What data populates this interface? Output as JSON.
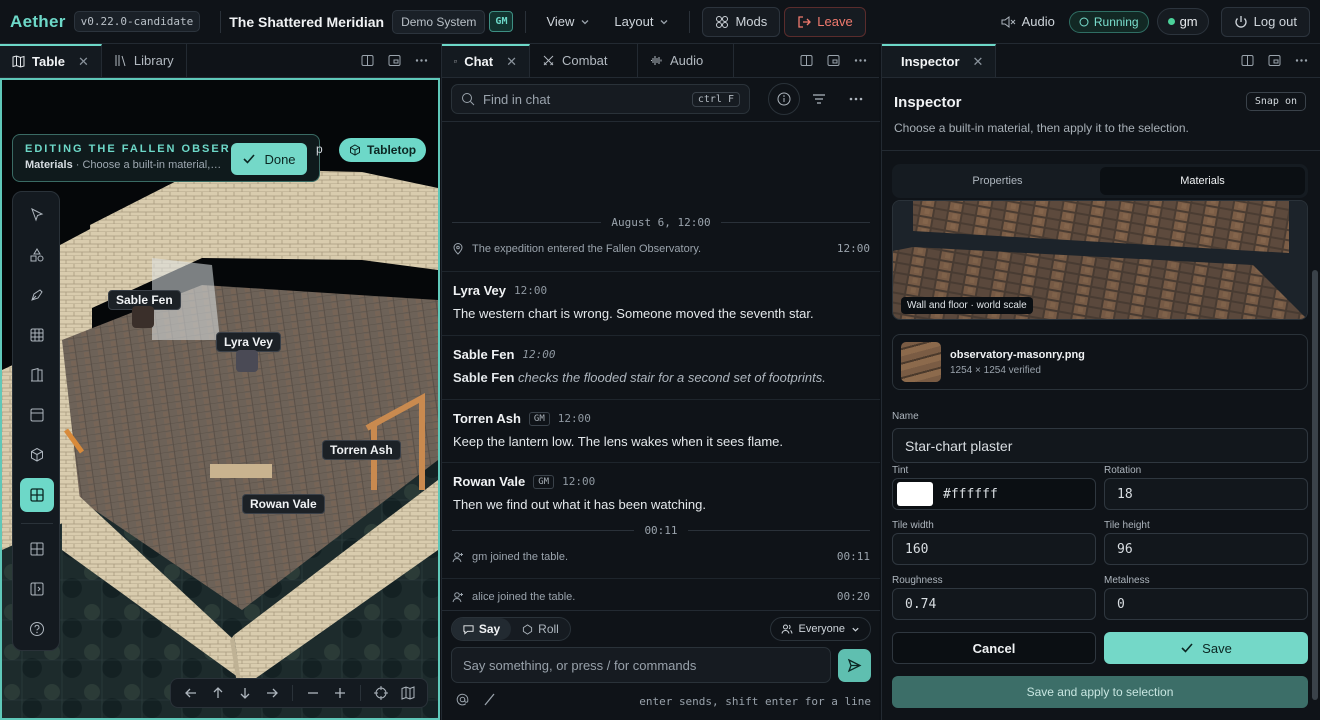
{
  "topbar": {
    "logo": "Aether",
    "version": "v0.22.0-candidate",
    "campaign_title": "The Shattered Meridian",
    "system": "Demo System",
    "role_badge": "GM",
    "menu_view": "View",
    "menu_layout": "Layout",
    "mods_label": "Mods",
    "leave_label": "Leave",
    "audio_label": "Audio",
    "status_label": "Running",
    "user_name": "gm",
    "logout_label": "Log out"
  },
  "left_panel": {
    "tabs": [
      {
        "label": "Table"
      },
      {
        "label": "Library"
      }
    ],
    "edit_banner": {
      "heading": "EDITING THE FALLEN OBSER…",
      "context": "Materials",
      "detail": "· Choose a built-in material,…"
    },
    "done_label": "Done",
    "view_partial": "p",
    "tabletop_label": "Tabletop",
    "tokens": [
      {
        "name": "Sable Fen"
      },
      {
        "name": "Lyra Vey"
      },
      {
        "name": "Torren Ash"
      },
      {
        "name": "Rowan Vale"
      }
    ],
    "tool_icons": [
      "pointer-icon",
      "shapes-icon",
      "pen-icon",
      "grid-icon",
      "door-icon",
      "layout-icon",
      "cube-icon",
      "tiles-icon",
      "grid-small-icon",
      "sidebar-icon",
      "help-icon"
    ]
  },
  "chat_panel": {
    "tabs": [
      {
        "label": "Chat"
      },
      {
        "label": "Combat"
      },
      {
        "label": "Audio"
      }
    ],
    "find_placeholder": "Find in chat",
    "find_shortcut": "ctrl F",
    "date_separator": "August 6, 12:00",
    "system_entry": {
      "text": "The expedition entered the Fallen Observatory.",
      "time": "12:00"
    },
    "messages": [
      {
        "author": "Lyra Vey",
        "gm": false,
        "time": "12:00",
        "text": "The western chart is wrong. Someone moved the seventh star."
      },
      {
        "author": "Sable Fen",
        "gm": false,
        "time": "12:00",
        "actor": "Sable Fen",
        "emote": "checks the flooded stair for a second set of footprints."
      },
      {
        "author": "Torren Ash",
        "gm": true,
        "time": "12:00",
        "text": "Keep the lantern low. The lens wakes when it sees flame."
      },
      {
        "author": "Rowan Vale",
        "gm": true,
        "time": "12:00",
        "text": "Then we find out what it has been watching."
      }
    ],
    "gm_badge": "GM",
    "time_separator": "00:11",
    "joins": [
      {
        "text": "gm joined the table.",
        "time": "00:11"
      },
      {
        "text": "alice joined the table.",
        "time": "00:20"
      }
    ],
    "say_label": "Say",
    "roll_label": "Roll",
    "audience_label": "Everyone",
    "input_placeholder": "Say something, or press / for commands",
    "hint": "enter sends, shift enter for a line"
  },
  "inspector": {
    "tab_label": "Inspector",
    "title": "Inspector",
    "subtitle": "Choose a built-in material, then apply it to the selection.",
    "snap_label": "Snap on",
    "segments": [
      {
        "label": "Properties"
      },
      {
        "label": "Materials"
      }
    ],
    "preview_label": "Wall and floor · world scale",
    "file": {
      "name": "observatory-masonry.png",
      "meta": "1254 × 1254 verified"
    },
    "fields": {
      "name": {
        "label": "Name",
        "value": "Star-chart plaster"
      },
      "tint": {
        "label": "Tint",
        "value": "#ffffff"
      },
      "rotation": {
        "label": "Rotation",
        "value": "18"
      },
      "tile_width": {
        "label": "Tile width",
        "value": "160"
      },
      "tile_height": {
        "label": "Tile height",
        "value": "96"
      },
      "roughness": {
        "label": "Roughness",
        "value": "0.74"
      },
      "metalness": {
        "label": "Metalness",
        "value": "0"
      }
    },
    "cancel_label": "Cancel",
    "save_label": "Save",
    "apply_label": "Save and apply to selection"
  },
  "colors": {
    "accent": "#6dd8c8",
    "leave": "#f07a6e",
    "running": "#4bd29a"
  }
}
